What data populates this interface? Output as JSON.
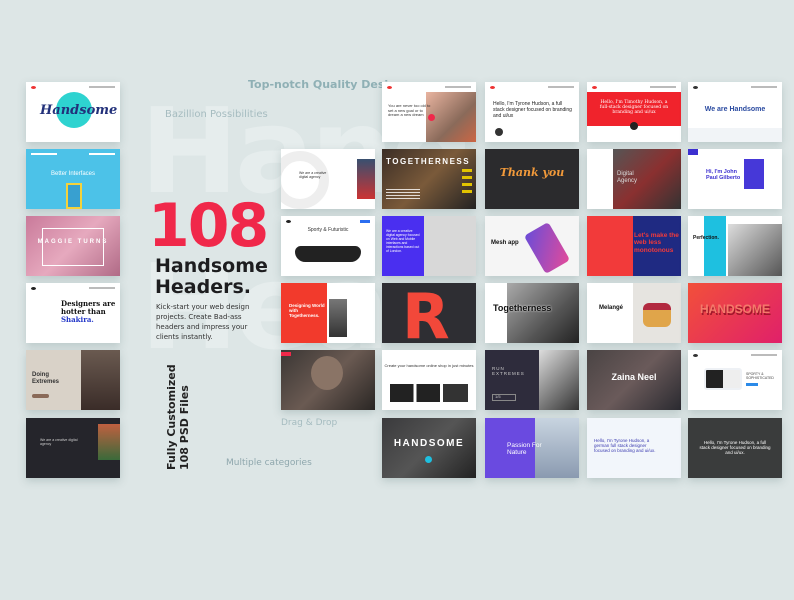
{
  "watermark": {
    "line1": "Hand",
    "line2": "Hea"
  },
  "labels": {
    "top_notch": "Top-notch Quality Designs",
    "bazillion": "Bazillion Possibilities",
    "drag_drop": "Drag & Drop",
    "multiple_categories": "Multiple categories",
    "vertical_line1": "Fully Customized",
    "vertical_line2": "108 PSD Files"
  },
  "hero": {
    "number": "108",
    "title_line1": "Handsome",
    "title_line2": "Headers.",
    "description": "Kick-start your web design projects. Create Bad-ass headers and impress your clients instantly."
  },
  "colors": {
    "accent": "#f0284a",
    "background": "#dde6e6",
    "label": "#8aa9ae"
  },
  "thumbnails": [
    {
      "text": "Handsome"
    },
    {
      "text": "Better Interfaces"
    },
    {
      "text": "MAGGIE TURNS"
    },
    {
      "text": "Designers are hotter than",
      "text2": "Shakira."
    },
    {
      "text": "Doing Extremes"
    },
    {
      "text": "We are a creative digital agency"
    },
    {
      "text": "You are never too old to set a new goal or to dream a new dream"
    },
    {
      "text": "Hello, I'm Tyrone Hudson, a full stack designer focused on branding and ui/ux"
    },
    {
      "text": "Hello, I'm Timothy Hudson, a full-stack designer focused on branding and ui/ux"
    },
    {
      "text": "We are Handsome"
    },
    {
      "text": "We are a creative digital agency"
    },
    {
      "text": "TOGETHERNESS"
    },
    {
      "text": "Thank you"
    },
    {
      "text": "Digital Agency"
    },
    {
      "text": "Hi, I'm John Paul Gilberto"
    },
    {
      "text": "Sporty & Futuristic"
    },
    {
      "text": "We are a creative digital agency focused on Web and Mobile interfaces and interactions based out of London."
    },
    {
      "text": "Mesh app"
    },
    {
      "text": "Let's make the web less monotonous"
    },
    {
      "text": "Perfection."
    },
    {
      "text": "Designing World with Togetherness."
    },
    {
      "text": "R"
    },
    {
      "text": "Togetherness"
    },
    {
      "text": "Melangé"
    },
    {
      "text": "HANDSOME"
    },
    {
      "text": "Create your handsome online shop in just minutes"
    },
    {
      "text": "RUN EXTREMES",
      "text2": "1/5"
    },
    {
      "text": "Zaina Neel"
    },
    {
      "text": "SPORTY & SOPHISTICATED"
    },
    {
      "text": "HANDSOME"
    },
    {
      "text": "Passion For Nature"
    },
    {
      "text": "Hello, I'm Tyrone Hudson, a german full stack designer focused on branding and ui/ux."
    },
    {
      "text": "Hello, I'm Tyrone Hudson, a full stack designer focused on branding and ui/ux."
    }
  ]
}
